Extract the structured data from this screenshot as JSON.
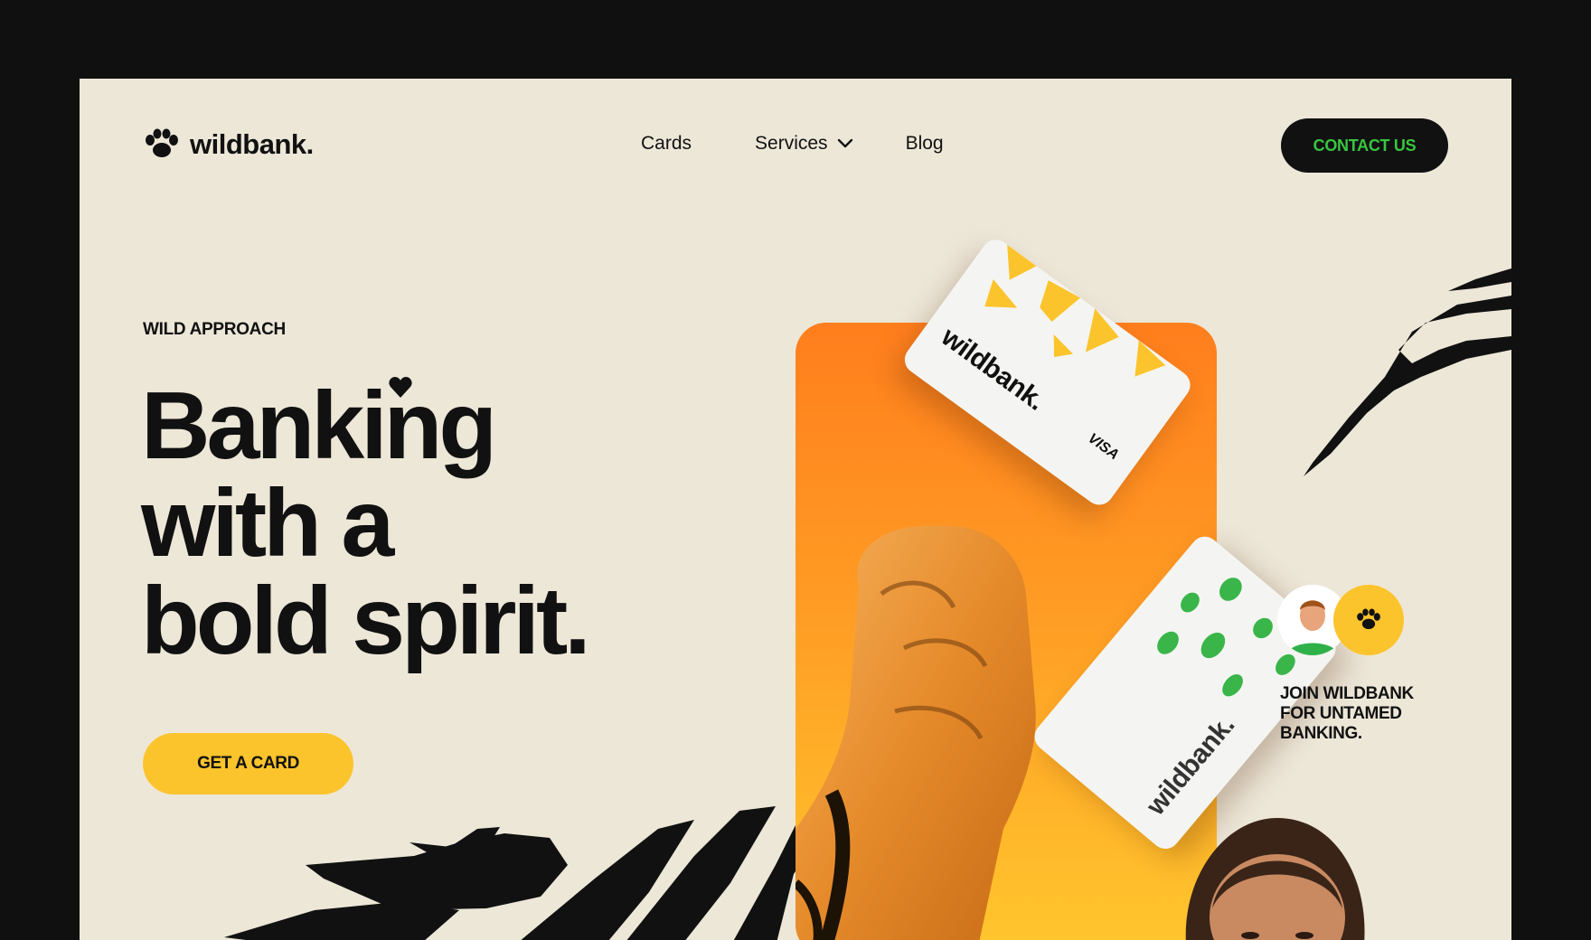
{
  "brand": {
    "name": "wildbank."
  },
  "nav": {
    "items": [
      {
        "label": "Cards"
      },
      {
        "label": "Services"
      },
      {
        "label": "Blog"
      }
    ],
    "contact_label": "CONTACT US"
  },
  "hero": {
    "eyebrow": "WILD APPROACH",
    "headline_lines": [
      "Banking",
      "with a",
      "bold spirit."
    ],
    "cta_label": "GET A CARD"
  },
  "cards": {
    "card1": {
      "brand": "wildbank.",
      "network": "VISA"
    },
    "card2": {
      "brand": "wildbank."
    }
  },
  "side": {
    "join_lines": [
      "JOIN WILDBANK",
      "FOR UNTAMED",
      "BANKING."
    ]
  },
  "colors": {
    "background": "#ede7d8",
    "frame_border": "#101010",
    "accent_yellow": "#fcc42c",
    "accent_orange": "#ff7e1d",
    "accent_green": "#38c63f",
    "ink": "#111111"
  },
  "icons": {
    "logo": "paw-icon",
    "dropdown": "chevron-down-icon",
    "heart": "heart-icon"
  }
}
